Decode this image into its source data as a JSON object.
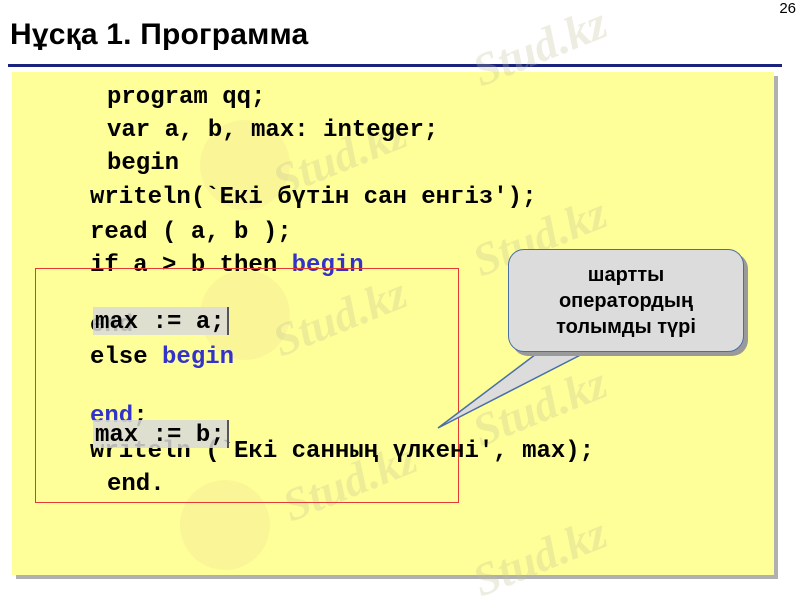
{
  "page": {
    "title": "Нұсқа 1. Программа",
    "page_number": "26"
  },
  "watermark": {
    "text": "Stud.kz"
  },
  "code_lines": {
    "l1": "program qq;",
    "l2": "var a, b, max: integer;",
    "l3": "begin",
    "l4": "writeln(`Екі бүтін сан енгіз');",
    "l5_pre": "read ( a, b );",
    "l6_pre": "if a > b then ",
    "l6_kw": "begin",
    "l7": "end",
    "l8_pre": "else ",
    "l8_kw": "begin",
    "l9_kw": "end",
    "l9_post": ";",
    "l10": "writeln (`Екі санның үлкені', max);",
    "l11": "end."
  },
  "hints": {
    "max_a": "max := a;",
    "max_b": "max := b;"
  },
  "callout": {
    "line1": "шартты",
    "line2": "оператордың",
    "line3": "толымды түрі"
  },
  "colors": {
    "panel_bg": "#ffff99",
    "keyword_blue": "#3333cc",
    "title_rule": "#1a237e",
    "red_frame": "#e53935",
    "callout_bg": "#dcdcdc"
  }
}
